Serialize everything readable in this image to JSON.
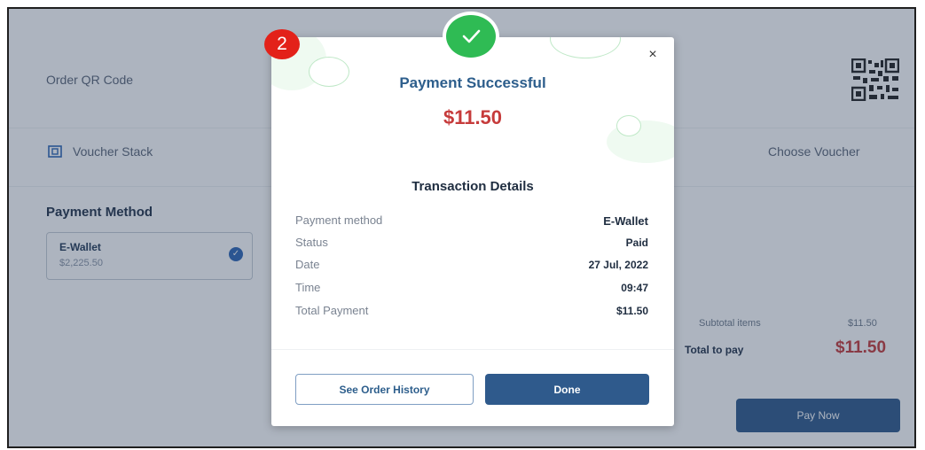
{
  "step_marker": "2",
  "background": {
    "order_qr_label": "Order QR Code",
    "voucher_stack_label": "Voucher Stack",
    "choose_voucher_label": "Choose Voucher",
    "payment_method_heading": "Payment Method",
    "wallet": {
      "name": "E-Wallet",
      "balance": "$2,225.50",
      "selected": true
    },
    "summary": {
      "subtotal_label": "Subtotal items",
      "subtotal_value": "$11.50",
      "total_label": "Total to pay",
      "total_value": "$11.50"
    },
    "pay_now_label": "Pay Now"
  },
  "modal": {
    "title": "Payment Successful",
    "amount": "$11.50",
    "close_label": "×",
    "details_title": "Transaction Details",
    "details": [
      {
        "label": "Payment method",
        "value": "E-Wallet"
      },
      {
        "label": "Status",
        "value": "Paid"
      },
      {
        "label": "Date",
        "value": "27 Jul, 2022"
      },
      {
        "label": "Time",
        "value": "09:47"
      },
      {
        "label": "Total Payment",
        "value": "$11.50"
      }
    ],
    "buttons": {
      "history": "See Order History",
      "done": "Done"
    }
  },
  "icons": [
    "qr-code-icon",
    "voucher-icon",
    "check-icon",
    "close-icon",
    "success-check-icon"
  ],
  "colors": {
    "accent": "#2f5a8c",
    "title_blue": "#2d5e8c",
    "amount_red": "#c63b3b",
    "success_green": "#2fbb54",
    "marker_red": "#e32119"
  }
}
